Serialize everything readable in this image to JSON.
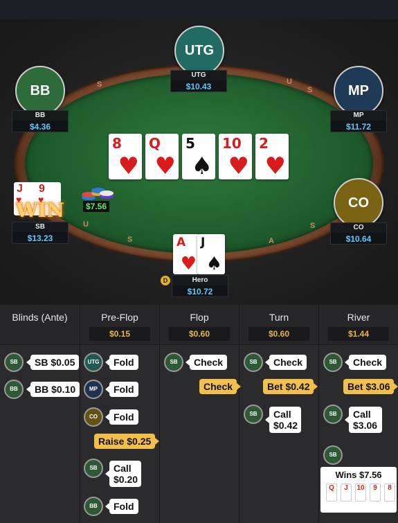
{
  "seats": {
    "utg": {
      "circle_label": "UTG",
      "name": "UTG",
      "stack": "$10.43"
    },
    "bb": {
      "circle_label": "BB",
      "name": "BB",
      "stack": "$4.36"
    },
    "mp": {
      "circle_label": "MP",
      "name": "MP",
      "stack": "$11.72"
    },
    "co": {
      "circle_label": "CO",
      "name": "CO",
      "stack": "$10.64"
    },
    "sb": {
      "name": "SB",
      "stack": "$13.23",
      "win_label": "WIN",
      "cards": [
        {
          "rank": "J",
          "suit": "♥"
        },
        {
          "rank": "9",
          "suit": "♥"
        }
      ]
    },
    "hero": {
      "name": "Hero",
      "stack": "$10.72",
      "dealer": "D",
      "cards": [
        {
          "rank": "A",
          "suit": "♥"
        },
        {
          "rank": "J",
          "suit": "♠"
        }
      ]
    }
  },
  "board": [
    {
      "rank": "8",
      "suit": "♥",
      "color": "red"
    },
    {
      "rank": "Q",
      "suit": "♥",
      "color": "red"
    },
    {
      "rank": "5",
      "suit": "♠",
      "color": "blk"
    },
    {
      "rank": "10",
      "suit": "♥",
      "color": "red"
    },
    {
      "rank": "2",
      "suit": "♥",
      "color": "red"
    }
  ],
  "pot_chips": "$7.56",
  "rail_letters": [
    "S",
    "U",
    "S",
    "A",
    "S",
    "U",
    "S",
    "A",
    "S"
  ],
  "history": {
    "columns": [
      {
        "title": "Blinds (Ante)",
        "pot": ""
      },
      {
        "title": "Pre-Flop",
        "pot": "$0.15"
      },
      {
        "title": "Flop",
        "pot": "$0.60"
      },
      {
        "title": "Turn",
        "pot": "$0.60"
      },
      {
        "title": "River",
        "pot": "$1.44"
      }
    ],
    "blinds": [
      {
        "pos": "SB",
        "action": "SB $0.05"
      },
      {
        "pos": "BB",
        "action": "BB $0.10"
      }
    ],
    "preflop": [
      {
        "pos": "UTG",
        "action": "Fold"
      },
      {
        "pos": "MP",
        "action": "Fold"
      },
      {
        "pos": "CO",
        "action": "Fold"
      },
      {
        "pos": "",
        "action": "Raise $0.25"
      },
      {
        "pos": "SB",
        "action": "Call $0.20"
      },
      {
        "pos": "BB",
        "action": "Fold"
      }
    ],
    "flop": [
      {
        "pos": "SB",
        "action": "Check"
      },
      {
        "pos": "",
        "action": "Check"
      }
    ],
    "turn": [
      {
        "pos": "SB",
        "action": "Check"
      },
      {
        "pos": "",
        "action": "Bet $0.42"
      },
      {
        "pos": "SB",
        "action": "Call $0.42"
      }
    ],
    "river": [
      {
        "pos": "SB",
        "action": "Check"
      },
      {
        "pos": "",
        "action": "Bet $3.06"
      },
      {
        "pos": "SB",
        "action": "Call $3.06"
      },
      {
        "pos": "SB",
        "action": "Wins $7.56"
      }
    ],
    "win_cards": [
      "Q",
      "J",
      "10",
      "9",
      "8"
    ]
  }
}
